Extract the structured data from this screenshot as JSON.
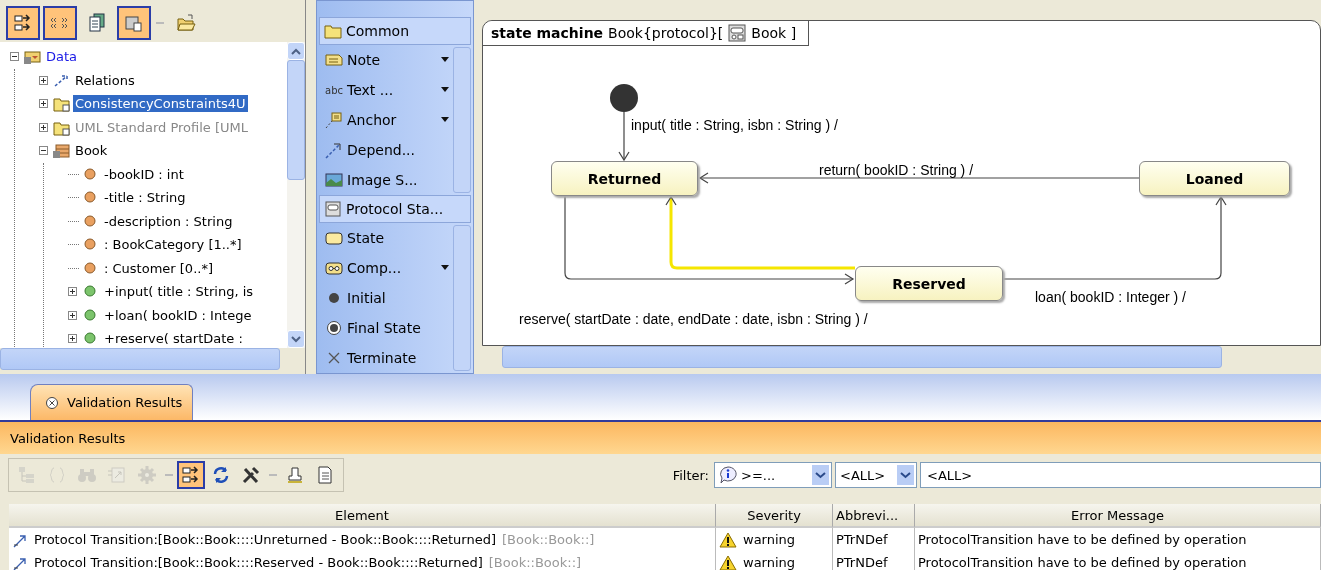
{
  "tree_toolbar": [
    {
      "kind": "split",
      "pressed": true
    },
    {
      "kind": "stereo",
      "pressed": true
    },
    {
      "kind": "docs",
      "pressed": false
    },
    {
      "kind": "package",
      "pressed": true
    },
    {
      "kind": "separator"
    },
    {
      "kind": "open",
      "pressed": false
    }
  ],
  "tree": {
    "items": [
      {
        "label": "Data",
        "kind": "model",
        "expanded": true,
        "selected": false,
        "children": [
          {
            "label": "Relations",
            "kind": "relations",
            "expanded": false,
            "selected": false
          },
          {
            "label": "ConsistencyConstraints4U",
            "kind": "package",
            "expanded": false,
            "selected": true
          },
          {
            "label": "UML Standard Profile [UML",
            "kind": "profile",
            "expanded": false,
            "selected": false
          },
          {
            "label": "Book",
            "kind": "class",
            "expanded": true,
            "selected": false,
            "children": [
              {
                "label": "-bookID : int",
                "kind": "attribute",
                "selected": false
              },
              {
                "label": "-title : String",
                "kind": "attribute",
                "selected": false
              },
              {
                "label": "-description : String",
                "kind": "attribute",
                "selected": false
              },
              {
                "label": " : BookCategory [1..*]",
                "kind": "attribute",
                "selected": false
              },
              {
                "label": " : Customer [0..*]",
                "kind": "attribute",
                "selected": false
              },
              {
                "label": "+input( title : String, is",
                "kind": "operation",
                "expanded": false,
                "selected": false
              },
              {
                "label": "+loan( bookID : Intege",
                "kind": "operation",
                "expanded": false,
                "selected": false
              },
              {
                "label": "+reserve( startDate :",
                "kind": "operation",
                "expanded": false,
                "selected": false
              }
            ]
          }
        ]
      }
    ]
  },
  "palette": [
    {
      "group": "Common",
      "kind": "folder",
      "items": [
        {
          "label": "Note",
          "kind": "note",
          "menu": true
        },
        {
          "label": "Text ...",
          "kind": "text",
          "menu": true,
          "icon_text": "abc"
        },
        {
          "label": "Anchor",
          "kind": "anchor",
          "menu": true
        },
        {
          "label": "Depend...",
          "kind": "dependency",
          "menu": false
        },
        {
          "label": "Image S...",
          "kind": "image",
          "menu": false
        }
      ]
    },
    {
      "group": "Protocol Sta...",
      "kind": "statemachine",
      "items": [
        {
          "label": "State",
          "kind": "state",
          "menu": false
        },
        {
          "label": "Comp...",
          "kind": "composite",
          "menu": true
        },
        {
          "label": "Initial",
          "kind": "initial",
          "menu": false
        },
        {
          "label": "Final State",
          "kind": "final",
          "menu": false
        },
        {
          "label": "Terminate",
          "kind": "terminate",
          "menu": false
        }
      ]
    }
  ],
  "diagram": {
    "frame": {
      "keyword": "state machine",
      "name": "Book{protocol}[",
      "context": "Book ]"
    },
    "states": [
      {
        "name": "Returned"
      },
      {
        "name": "Loaned"
      },
      {
        "name": "Reserved"
      }
    ],
    "transitions": [
      {
        "label": "input( title : String, isbn : String ) /",
        "highlighted": false
      },
      {
        "label": "return( bookID : String ) /",
        "highlighted": false
      },
      {
        "label": "reserve( startDate : date, endDate : date, isbn : String ) /",
        "highlighted": false
      },
      {
        "highlighted": true
      },
      {
        "label": "loan( bookID : Integer ) /",
        "highlighted": false
      }
    ]
  },
  "tabs": [
    {
      "label": "Validation Results",
      "selected": true
    }
  ],
  "panel": {
    "title": "Validation Results",
    "tools": [
      {
        "kind": "tree",
        "disabled": true,
        "pressed": false
      },
      {
        "kind": "braces",
        "disabled": true,
        "pressed": false
      },
      {
        "kind": "binoculars",
        "disabled": true,
        "pressed": false
      },
      {
        "kind": "navigate",
        "disabled": true,
        "pressed": false
      },
      {
        "kind": "gear",
        "disabled": true,
        "pressed": false
      },
      {
        "kind": "separator"
      },
      {
        "kind": "split",
        "disabled": false,
        "pressed": true
      },
      {
        "kind": "refresh",
        "disabled": false,
        "pressed": false
      },
      {
        "kind": "tools",
        "disabled": false,
        "pressed": false
      },
      {
        "kind": "separator"
      },
      {
        "kind": "stamp",
        "disabled": false,
        "pressed": false
      },
      {
        "kind": "document",
        "disabled": false,
        "pressed": false
      }
    ],
    "filter": {
      "label": "Filter:",
      "severity": ">=...",
      "abbreviation": "<ALL>",
      "text": "<ALL>"
    }
  },
  "table": {
    "columns": [
      "Element",
      "Severity",
      "Abbrevi...",
      "Error Message"
    ],
    "rows": [
      {
        "element": "Protocol Transition:[Book::Book::::Unreturned - Book::Book::::Returned]",
        "owner": "[Book::Book::]",
        "severity": "warning",
        "abbreviation": "PTrNDef",
        "message": "ProtocolTransition have to be defined by operation"
      },
      {
        "element": "Protocol Transition:[Book::Book::::Reserved - Book::Book::::Returned]",
        "owner": "[Book::Book::]",
        "severity": "warning",
        "abbreviation": "PTrNDef",
        "message": "ProtocolTransition have to be defined by operation"
      }
    ]
  }
}
